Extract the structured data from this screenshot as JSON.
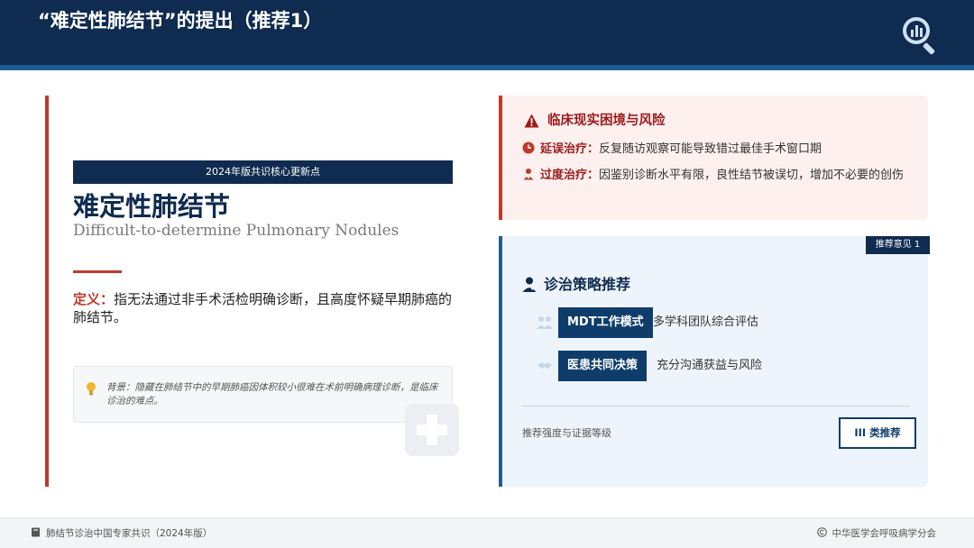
{
  "header": {
    "title": "“难定性肺结节”的提出（推荐1）",
    "icon": "chart-search-icon"
  },
  "left": {
    "badge": "2024年版共识核心更新点",
    "title": "难定性肺结节",
    "subtitle": "Difficult-to-determine Pulmonary Nodules",
    "definition_label": "定义：",
    "definition_text": "指无法通过非手术活检明确诊断，且高度怀疑早期肺癌的肺结节。",
    "background_text": "背景：隐藏在肺结节中的早期肺癌因体积较小很难在术前明确病理诊断，是临床诊治的难点。"
  },
  "risk": {
    "title": "临床现实困境与风险",
    "items": [
      {
        "label": "延误治疗：",
        "text": "反复随访观察可能导致错过最佳手术窗口期",
        "icon": "clock-icon"
      },
      {
        "label": "过度治疗：",
        "text": "因鉴别诊断水平有限，良性结节被误切，增加不必要的创伤",
        "icon": "surgeon-icon"
      }
    ]
  },
  "strategy": {
    "tag": "推荐意见 1",
    "title": "诊治策略推荐",
    "modes": [
      {
        "label": "MDT工作模式",
        "desc": "多学科团队综合评估",
        "icon": "team-icon"
      },
      {
        "label": "医患共同决策",
        "desc": "充分沟通获益与风险",
        "icon": "handshake-icon"
      }
    ],
    "evidence_label": "推荐强度与证据等级",
    "class_label": "III 类推荐"
  },
  "footer": {
    "left": "肺结节诊治中国专家共识（2024年版）",
    "right": "中华医学会呼吸病学分会"
  },
  "colors": {
    "navy": "#0f2b4f",
    "accent_blue": "#1f5d92",
    "accent_red": "#c0392b",
    "risk_bg": "#fdf0ef",
    "strategy_bg": "#eef4fb"
  }
}
